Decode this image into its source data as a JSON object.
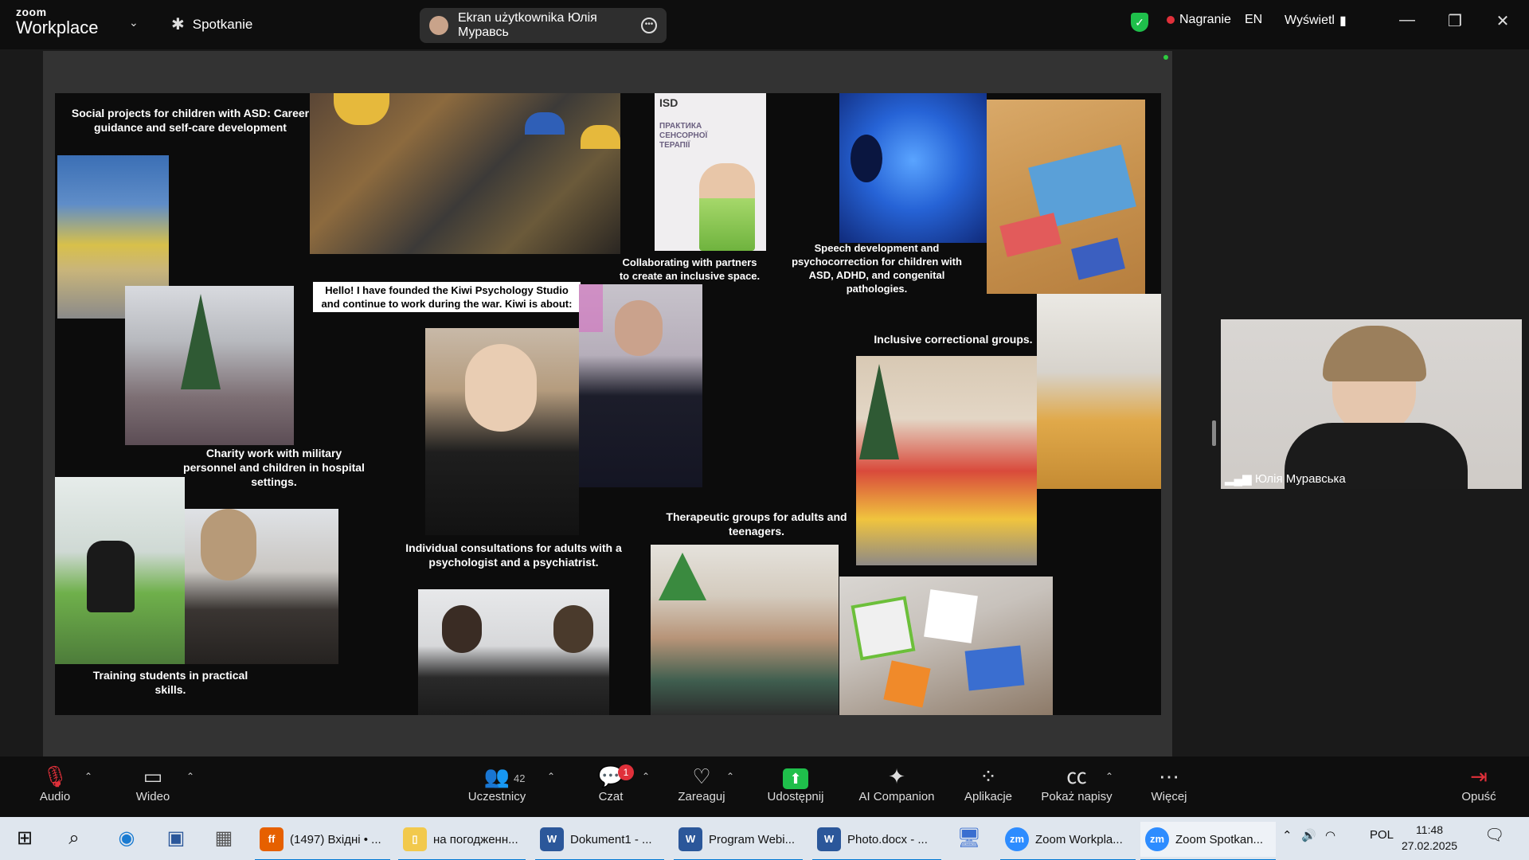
{
  "titlebar": {
    "brand_small": "zoom",
    "brand_large": "Workplace",
    "meeting_label": "Spotkanie",
    "share_label": "Ekran użytkownika Юлія Муравсь",
    "recording_label": "Nagranie",
    "language": "EN",
    "view_label": "Wyświetl",
    "status_color": "#1fbf4b"
  },
  "slide": {
    "captions": {
      "asd_projects": "Social projects for children with ASD: Career guidance and self-care development",
      "partners": "Collaborating with partners to create an inclusive space.",
      "speech": "Speech development and psychocorrection for children with ASD, ADHD, and congenital pathologies.",
      "kiwi": "Hello! I have founded the Kiwi Psychology Studio and continue to work during the war. Kiwi is about:",
      "charity": "Charity work with military personnel and children in hospital settings.",
      "inclusive": "Inclusive correctional groups.",
      "therapeutic": "Therapeutic groups for adults and teenagers.",
      "individual": "Individual consultations for adults with a psychologist and a psychiatrist.",
      "training": "Training students in practical skills."
    },
    "book": {
      "logo": "ISD",
      "title": "ПРАКТИКА СЕНСОРНОЇ ТЕРАПІЇ"
    }
  },
  "participant": {
    "name": "Юлія Муравська"
  },
  "toolbar": {
    "audio": "Audio",
    "video": "Wideo",
    "participants": "Uczestnicy",
    "participants_count": "42",
    "chat": "Czat",
    "chat_badge": "1",
    "react": "Zareaguj",
    "share": "Udostępnij",
    "ai": "AI Companion",
    "apps": "Aplikacje",
    "captions": "Pokaż napisy",
    "more": "Więcej",
    "leave": "Opuść"
  },
  "taskbar": {
    "apps": [
      {
        "label": "(1497) Вхідні • ...",
        "icon": "firefox-icon",
        "color": "#e66000"
      },
      {
        "label": "на погодженн...",
        "icon": "folder-icon",
        "color": "#f2c94c"
      },
      {
        "label": "Dokument1 - ...",
        "icon": "word-icon",
        "color": "#2b579a"
      },
      {
        "label": "Program Webi...",
        "icon": "word-icon",
        "color": "#2b579a"
      },
      {
        "label": "Photo.docx - ...",
        "icon": "word-icon",
        "color": "#2b579a"
      },
      {
        "label": "Zoom Workpla...",
        "icon": "zoom-icon",
        "color": "#2d8cff"
      },
      {
        "label": "Zoom Spotkan...",
        "icon": "zoom-icon",
        "color": "#2d8cff"
      }
    ],
    "language": "POL",
    "time": "11:48",
    "date": "27.02.2025"
  }
}
